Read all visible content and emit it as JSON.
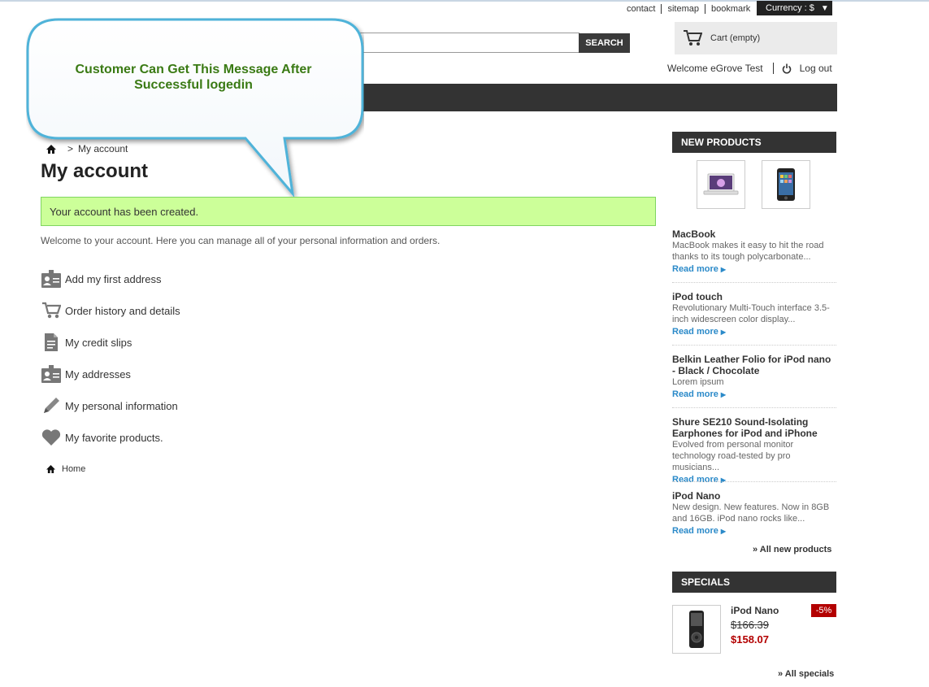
{
  "header": {
    "links": [
      "contact",
      "sitemap",
      "bookmark"
    ],
    "currency_label": "Currency : $",
    "search_button": "SEARCH",
    "cart_label": "Cart (empty)",
    "welcome_text": "Welcome eGrove Test",
    "logout_label": "Log out"
  },
  "callout": {
    "text": "Customer Can Get This Message After Successful logedin"
  },
  "breadcrumb": {
    "separator": ">",
    "current": "My account"
  },
  "main": {
    "title": "My account",
    "success_message": "Your account has been created.",
    "intro": "Welcome to your account. Here you can manage all of your personal information and orders.",
    "menu": [
      {
        "label": "Add my first address",
        "icon": "address-card-icon"
      },
      {
        "label": "Order history and details",
        "icon": "cart-icon"
      },
      {
        "label": "My credit slips",
        "icon": "document-icon"
      },
      {
        "label": "My addresses",
        "icon": "address-card-icon"
      },
      {
        "label": "My personal information",
        "icon": "pencil-icon"
      },
      {
        "label": "My favorite products.",
        "icon": "heart-icon"
      }
    ],
    "home_link": "Home"
  },
  "sidebar": {
    "new_products_title": "NEW PRODUCTS",
    "products": [
      {
        "name": "MacBook",
        "desc": "MacBook makes it easy to hit the road thanks to its tough polycarbonate...",
        "read_more": "Read more"
      },
      {
        "name": "iPod touch",
        "desc": "Revolutionary Multi-Touch interface 3.5-inch widescreen color display...",
        "read_more": "Read more"
      },
      {
        "name": "Belkin Leather Folio for iPod nano - Black / Chocolate",
        "desc": "Lorem ipsum",
        "read_more": "Read more"
      },
      {
        "name": "Shure SE210 Sound-Isolating Earphones for iPod and iPhone",
        "desc": "Evolved from personal monitor technology road-tested by pro musicians...",
        "read_more": "Read more"
      },
      {
        "name": "iPod Nano",
        "desc": "New design. New features. Now in 8GB and 16GB. iPod nano rocks like...",
        "read_more": "Read more"
      }
    ],
    "all_new_products": "» All new products",
    "specials_title": "SPECIALS",
    "special": {
      "name": "iPod Nano",
      "old_price": "$166.39",
      "new_price": "$158.07",
      "discount": "-5%"
    },
    "all_specials": "» All specials"
  },
  "colors": {
    "success_bg": "#ccff99",
    "callout_text": "#3a7a14",
    "link": "#2b8ac9",
    "price": "#b30000",
    "dark_bar": "#333333"
  }
}
